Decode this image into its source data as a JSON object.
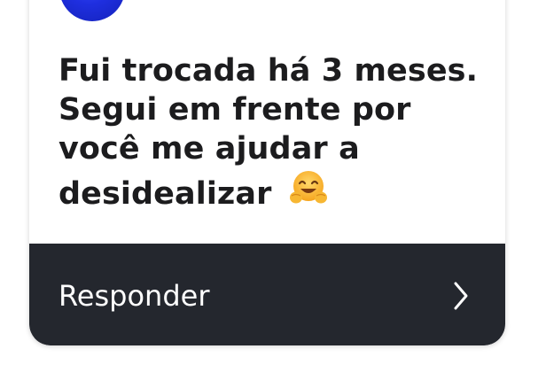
{
  "card": {
    "message_lines": [
      "Fui trocada há 3 meses.",
      "Segui em frente por",
      "você me ajudar a",
      "desidealizar"
    ],
    "emoji": "hugging-face-emoji"
  },
  "reply": {
    "label": "Responder",
    "icon": "chevron-right-icon"
  },
  "colors": {
    "reply_bar": "#24272e",
    "message_text": "#1c1c1e",
    "avatar": "#1f2fe0"
  }
}
